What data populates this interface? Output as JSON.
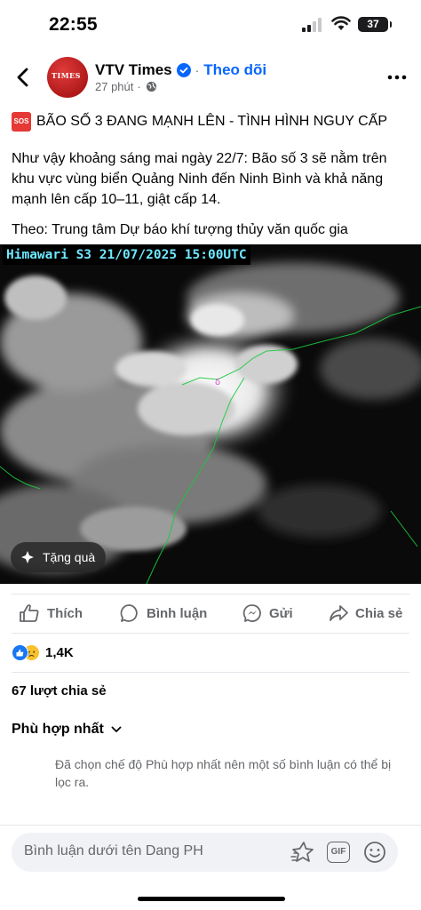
{
  "status_bar": {
    "time": "22:55",
    "battery": "37"
  },
  "post": {
    "author": "VTV Times",
    "follow_label": "Theo dõi",
    "time_ago": "27 phút",
    "meta_separator": "·",
    "avatar_text": "TIMES",
    "headline": "BÃO SỐ 3 ĐANG MẠNH LÊN - TÌNH HÌNH NGUY CẤP",
    "sos_label": "SOS",
    "paragraph": "Như vậy khoảng sáng mai ngày 22/7: Bão số 3 sẽ nằm trên khu vực vùng biển Quảng Ninh đến Ninh Bình và khả năng mạnh lên cấp 10–11, giật cấp 14.",
    "source": "Theo: Trung tâm Dự báo khí tượng thủy văn quốc gia",
    "image_caption": "Himawari S3 21/07/2025 15:00UTC",
    "gift_label": "Tặng quà"
  },
  "actions": {
    "like": "Thích",
    "comment": "Bình luận",
    "send": "Gửi",
    "share": "Chia sẻ"
  },
  "reactions": {
    "count": "1,4K",
    "types": [
      "like",
      "sad"
    ]
  },
  "shares_text": "67 lượt chia sẻ",
  "comments": {
    "sort_label": "Phù hợp nhất",
    "filter_notice": "Đã chọn chế độ Phù hợp nhất nên một số bình luận có thể bị lọc ra."
  },
  "composer": {
    "placeholder": "Bình luận dưới tên Dang PH",
    "gif_label": "GIF"
  },
  "colors": {
    "accent": "#0866ff",
    "text": "#050505",
    "secondary": "#65676b",
    "sos_red": "#e53935",
    "caption_cyan": "#6ee8ff"
  },
  "icons": [
    "back-arrow-icon",
    "verified-badge-icon",
    "globe-icon",
    "more-dots-icon",
    "sparkle-gift-icon",
    "thumbs-up-icon",
    "comment-bubble-icon",
    "messenger-icon",
    "share-arrow-icon",
    "chevron-down-icon",
    "avatar-sticker-icon",
    "gif-icon",
    "emoji-icon"
  ]
}
